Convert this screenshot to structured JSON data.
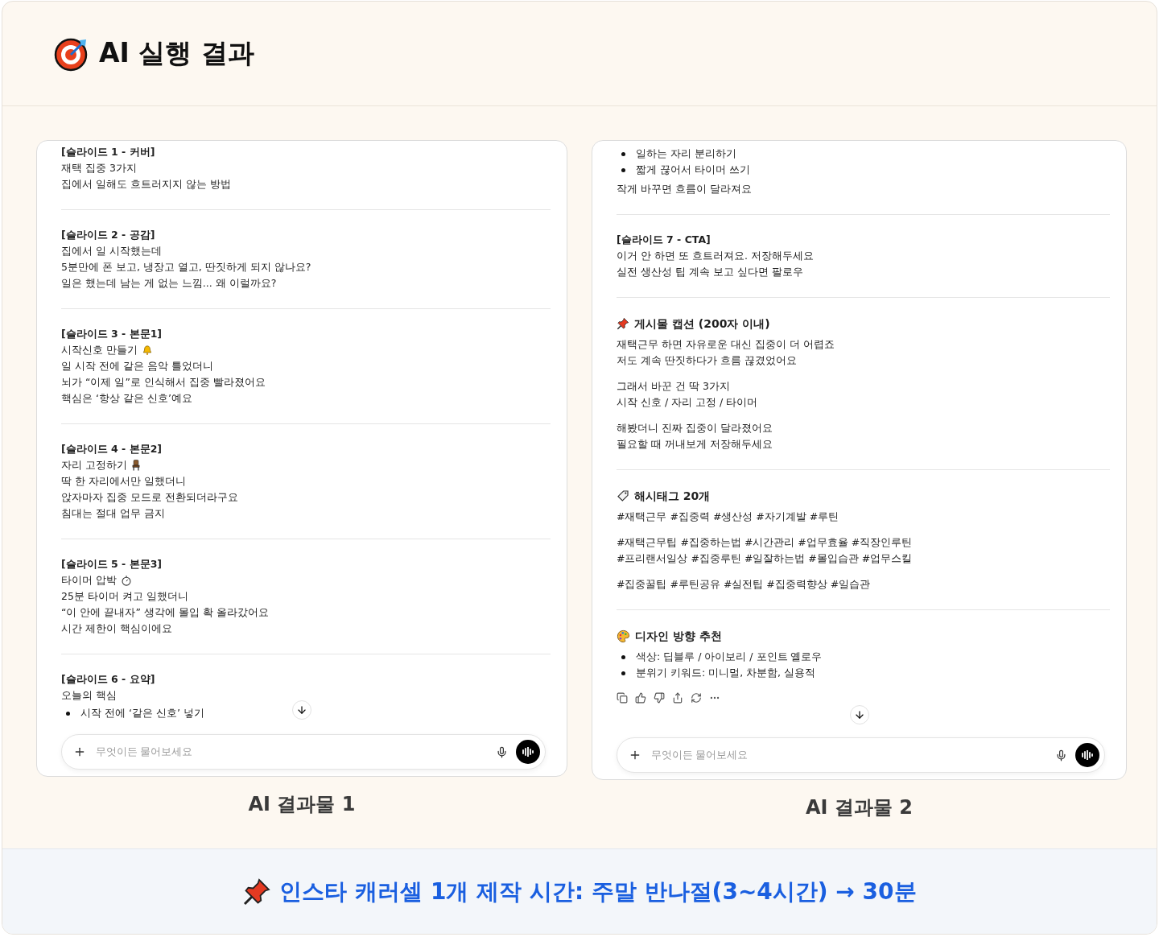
{
  "header": {
    "title": "AI 실행 결과"
  },
  "panels": [
    {
      "caption": "AI 결과물 1",
      "composer": {
        "placeholder": "무엇이든 물어보세요"
      },
      "show_actions": false,
      "blocks": [
        {
          "heading": {
            "kind": "slide",
            "text": "[슬라이드 1 - 커버]"
          },
          "parts": [
            {
              "kind": "lines",
              "lines": [
                "재택 집중 3가지",
                "집에서 일해도 흐트러지지 않는 방법"
              ]
            }
          ]
        },
        {
          "heading": {
            "kind": "slide",
            "text": "[슬라이드 2 - 공감]"
          },
          "parts": [
            {
              "kind": "lines",
              "lines": [
                "집에서 일 시작했는데",
                "5분만에 폰 보고, 냉장고 열고, 딴짓하게 되지 않나요?",
                "일은 했는데 남는 게 없는 느낌... 왜 이럴까요?"
              ]
            }
          ]
        },
        {
          "heading": {
            "kind": "slide",
            "text": "[슬라이드 3 - 본문1]"
          },
          "parts": [
            {
              "kind": "lines",
              "lines": [
                {
                  "text": "시작신호 만들기",
                  "kind": "bell"
                },
                "일 시작 전에 같은 음악 틀었더니",
                "뇌가 “이제 일”로 인식해서 집중 빨라졌어요",
                "핵심은 ‘항상 같은 신호’예요"
              ]
            }
          ]
        },
        {
          "heading": {
            "kind": "slide",
            "text": "[슬라이드 4 - 본문2]"
          },
          "parts": [
            {
              "kind": "lines",
              "lines": [
                {
                  "text": "자리 고정하기",
                  "kind": "chair"
                },
                "딱 한 자리에서만 일했더니",
                "앉자마자 집중 모드로 전환되더라구요",
                "침대는 절대 업무 금지"
              ]
            }
          ]
        },
        {
          "heading": {
            "kind": "slide",
            "text": "[슬라이드 5 - 본문3]"
          },
          "parts": [
            {
              "kind": "lines",
              "lines": [
                {
                  "text": "타이머 압박",
                  "kind": "stopwatch"
                },
                "25분 타이머 켜고 일했더니",
                "“이 안에 끝내자” 생각에 몰입 확 올라갔어요",
                "시간 제한이 핵심이에요"
              ]
            }
          ]
        },
        {
          "heading": {
            "kind": "slide",
            "text": "[슬라이드 6 - 요약]"
          },
          "parts": [
            {
              "kind": "lines",
              "lines": [
                "오늘의 핵심"
              ]
            },
            {
              "kind": "bullets",
              "lines": [
                "시작 전에 ‘같은 신호’ 넣기"
              ]
            }
          ]
        }
      ]
    },
    {
      "caption": "AI 결과물 2",
      "composer": {
        "placeholder": "무엇이든 물어보세요"
      },
      "show_actions": true,
      "blocks": [
        {
          "parts": [
            {
              "kind": "bullets",
              "lines": [
                "일하는 자리 분리하기",
                "짧게 끊어서 타이머 쓰기"
              ]
            },
            {
              "kind": "lines",
              "lines": [
                "작게 바꾸면 흐름이 달라져요"
              ]
            }
          ]
        },
        {
          "heading": {
            "kind": "slide",
            "text": "[슬라이드 7 - CTA]"
          },
          "parts": [
            {
              "kind": "lines",
              "lines": [
                "이거 안 하면 또 흐트러져요. 저장해두세요",
                "실전 생산성 팁 계속 보고 싶다면 팔로우"
              ]
            }
          ]
        },
        {
          "heading": {
            "kind": "pin",
            "text": "게시물 캡션 (200자 이내)"
          },
          "parts": [
            {
              "kind": "lines",
              "lines": [
                "재택근무 하면 자유로운 대신 집중이 더 어렵죠",
                "저도 계속 딴짓하다가 흐름 끊겼었어요"
              ]
            },
            {
              "kind": "lines",
              "lines": [
                "그래서 바꾼 건 딱 3가지",
                "시작 신호 / 자리 고정 / 타이머"
              ]
            },
            {
              "kind": "lines",
              "lines": [
                "해봤더니 진짜 집중이 달라졌어요",
                "필요할 때 꺼내보게 저장해두세요"
              ]
            }
          ]
        },
        {
          "heading": {
            "kind": "tag",
            "text": "해시태그 20개"
          },
          "parts": [
            {
              "kind": "lines",
              "lines": [
                "#재택근무 #집중력 #생산성 #자기계발 #루틴"
              ]
            },
            {
              "kind": "lines",
              "lines": [
                "#재택근무팁 #집중하는법 #시간관리 #업무효율 #직장인루틴",
                "#프리랜서일상 #집중루틴 #일잘하는법 #몰입습관 #업무스킬"
              ]
            },
            {
              "kind": "lines",
              "lines": [
                "#집중꿀팁 #루틴공유 #실전팁 #집중력향상 #일습관"
              ]
            }
          ]
        },
        {
          "heading": {
            "kind": "palette",
            "text": "디자인 방향 추천"
          },
          "parts": [
            {
              "kind": "bullets",
              "lines": [
                "색상: 딥블루 / 아이보리 / 포인트 옐로우",
                "분위기 키워드: 미니멀, 차분함, 실용적"
              ]
            }
          ]
        }
      ]
    }
  ],
  "footer": {
    "text": "인스타 캐러셀 1개 제작 시간: 주말 반나절(3~4시간) → 30분"
  }
}
